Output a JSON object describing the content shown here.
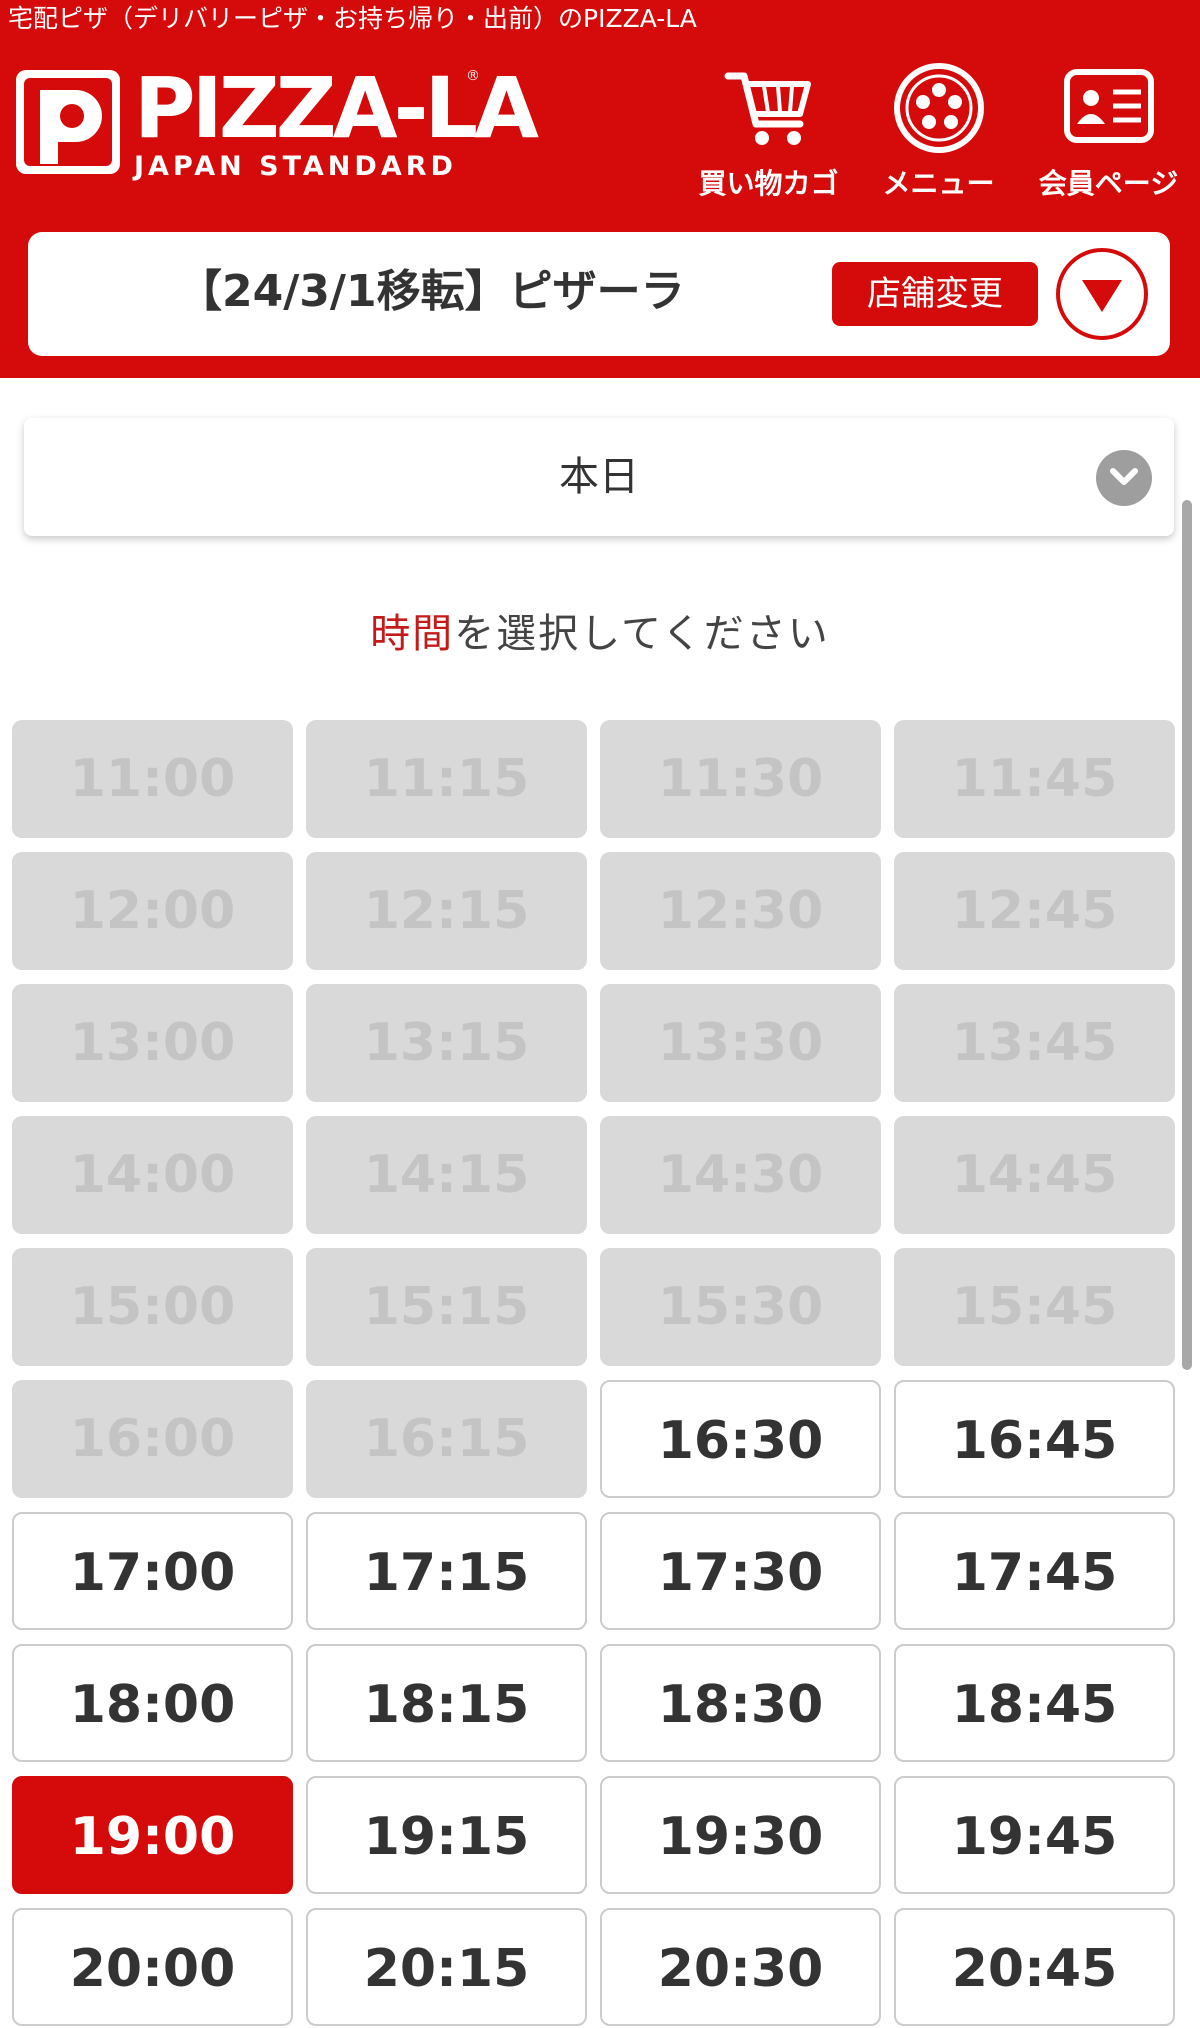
{
  "header": {
    "caption": "宅配ピザ（デリバリーピザ・お持ち帰り・出前）のPIZZA-LA",
    "logo": {
      "wordmark": "PIZZA-LA",
      "tagline": "JAPAN STANDARD",
      "reg_mark": "®"
    },
    "nav": [
      {
        "label": "買い物カゴ",
        "icon": "cart-icon"
      },
      {
        "label": "メニュー",
        "icon": "pizza-icon"
      },
      {
        "label": "会員ページ",
        "icon": "member-card-icon"
      }
    ],
    "store": {
      "name": "【24/3/1移転】ピザーラ",
      "change_label": "店舗変更",
      "toggle_icon": "triangle-down-icon"
    }
  },
  "date_select": {
    "value": "本日",
    "icon": "chevron-down-icon"
  },
  "prompt": {
    "accent": "時間",
    "rest": "を選択してください"
  },
  "colors": {
    "brand_red": "#d50a0a",
    "disabled_bg": "#d9d9d9",
    "disabled_text": "#c4c4c4"
  },
  "time_slots": [
    {
      "time": "11:00",
      "state": "disabled"
    },
    {
      "time": "11:15",
      "state": "disabled"
    },
    {
      "time": "11:30",
      "state": "disabled"
    },
    {
      "time": "11:45",
      "state": "disabled"
    },
    {
      "time": "12:00",
      "state": "disabled"
    },
    {
      "time": "12:15",
      "state": "disabled"
    },
    {
      "time": "12:30",
      "state": "disabled"
    },
    {
      "time": "12:45",
      "state": "disabled"
    },
    {
      "time": "13:00",
      "state": "disabled"
    },
    {
      "time": "13:15",
      "state": "disabled"
    },
    {
      "time": "13:30",
      "state": "disabled"
    },
    {
      "time": "13:45",
      "state": "disabled"
    },
    {
      "time": "14:00",
      "state": "disabled"
    },
    {
      "time": "14:15",
      "state": "disabled"
    },
    {
      "time": "14:30",
      "state": "disabled"
    },
    {
      "time": "14:45",
      "state": "disabled"
    },
    {
      "time": "15:00",
      "state": "disabled"
    },
    {
      "time": "15:15",
      "state": "disabled"
    },
    {
      "time": "15:30",
      "state": "disabled"
    },
    {
      "time": "15:45",
      "state": "disabled"
    },
    {
      "time": "16:00",
      "state": "disabled"
    },
    {
      "time": "16:15",
      "state": "disabled"
    },
    {
      "time": "16:30",
      "state": "available"
    },
    {
      "time": "16:45",
      "state": "available"
    },
    {
      "time": "17:00",
      "state": "available"
    },
    {
      "time": "17:15",
      "state": "available"
    },
    {
      "time": "17:30",
      "state": "available"
    },
    {
      "time": "17:45",
      "state": "available"
    },
    {
      "time": "18:00",
      "state": "available"
    },
    {
      "time": "18:15",
      "state": "available"
    },
    {
      "time": "18:30",
      "state": "available"
    },
    {
      "time": "18:45",
      "state": "available"
    },
    {
      "time": "19:00",
      "state": "selected"
    },
    {
      "time": "19:15",
      "state": "available"
    },
    {
      "time": "19:30",
      "state": "available"
    },
    {
      "time": "19:45",
      "state": "available"
    },
    {
      "time": "20:00",
      "state": "available"
    },
    {
      "time": "20:15",
      "state": "available"
    },
    {
      "time": "20:30",
      "state": "available"
    },
    {
      "time": "20:45",
      "state": "available"
    }
  ]
}
